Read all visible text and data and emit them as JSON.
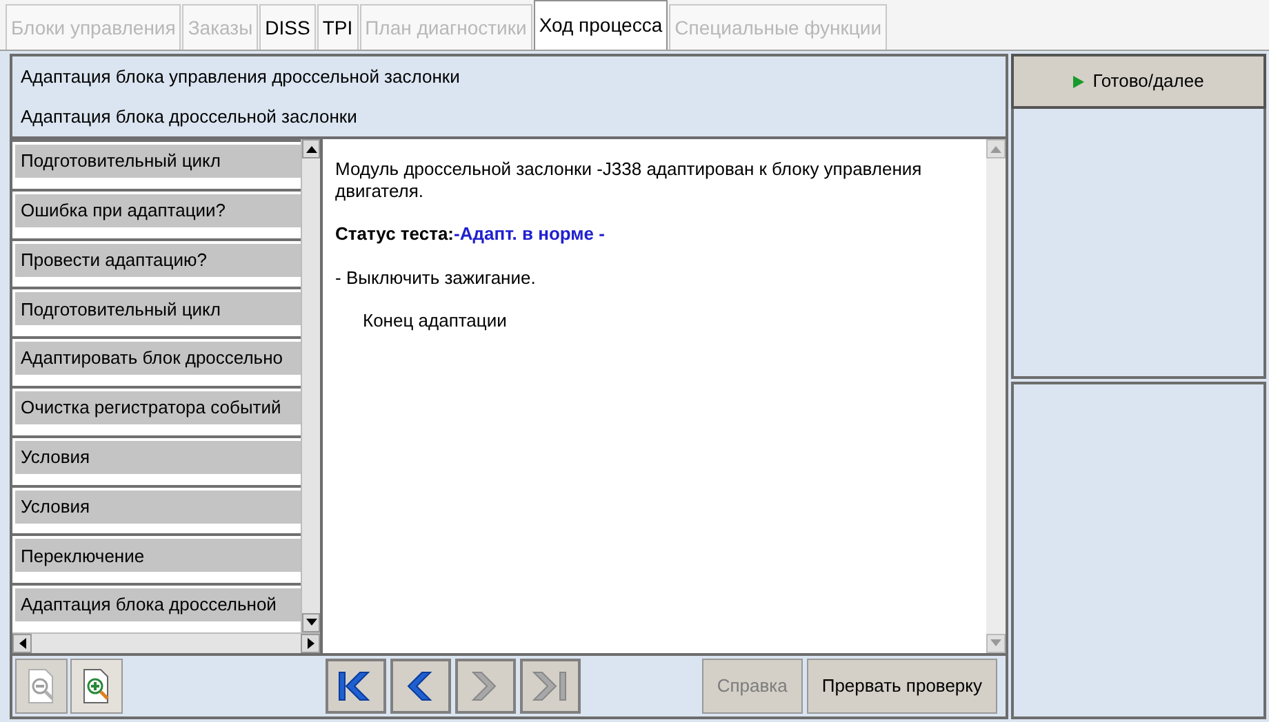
{
  "tabs": [
    {
      "label": "Блоки управления",
      "selected": false,
      "disabled": true
    },
    {
      "label": "Заказы",
      "selected": false,
      "disabled": true
    },
    {
      "label": "DISS",
      "selected": false,
      "disabled": false
    },
    {
      "label": "TPI",
      "selected": false,
      "disabled": false
    },
    {
      "label": "План диагностики",
      "selected": false,
      "disabled": true
    },
    {
      "label": "Ход процесса",
      "selected": true,
      "disabled": false
    },
    {
      "label": "Специальные функции",
      "selected": false,
      "disabled": true
    }
  ],
  "header": {
    "title": "Адаптация блока управления дроссельной заслонки",
    "subtitle": "Адаптация блока дроссельной заслонки"
  },
  "steps": [
    "Подготовительный цикл",
    "Ошибка при адаптации?",
    "Провести адаптацию?",
    "Подготовительный цикл",
    "Адаптировать блок дроссельно",
    "Очистка регистратора событий",
    "Условия",
    "Условия",
    "Переключение",
    "Адаптация блока дроссельной"
  ],
  "content": {
    "message": "Модуль дроссельной заслонки -J338 адаптирован к блоку управления двигателя.",
    "status_label": "Статус теста:",
    "status_value": "-Адапт. в норме -",
    "instruction": "- Выключить зажигание.",
    "end": "Конец адаптации"
  },
  "next_button": {
    "label": "Готово/далее"
  },
  "zoom_buttons": [
    {
      "kind": "zoom-out",
      "disabled": true
    },
    {
      "kind": "zoom-in",
      "disabled": false
    }
  ],
  "nav_buttons": [
    {
      "kind": "first",
      "disabled": false
    },
    {
      "kind": "prev",
      "disabled": false
    },
    {
      "kind": "next",
      "disabled": true
    },
    {
      "kind": "last",
      "disabled": true
    }
  ],
  "action_buttons": [
    {
      "label": "Справка",
      "disabled": true
    },
    {
      "label": "Прервать проверку",
      "disabled": false
    }
  ]
}
